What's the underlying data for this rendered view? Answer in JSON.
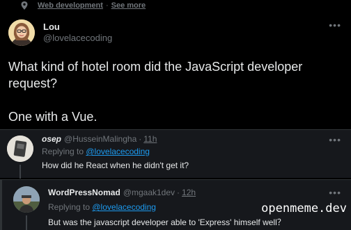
{
  "topic": {
    "label": "Web development",
    "separator": "·",
    "see_more": "See more"
  },
  "main_tweet": {
    "name": "Lou",
    "handle": "@lovelacecoding",
    "more": "•••",
    "text_line1": "What kind of hotel room did the JavaScript developer request?",
    "text_line2": "One with a Vue."
  },
  "replies": [
    {
      "name": "osep",
      "handle": "@HusseinMalingha",
      "separator": "·",
      "time": "11h",
      "more": "•••",
      "replying_prefix": "Replying to ",
      "replying_to": "@lovelacecoding",
      "text": "How did he React when he didn't get it?"
    },
    {
      "name": "WordPressNomad",
      "handle": "@mgaak1dev",
      "separator": "·",
      "time": "12h",
      "more": "•••",
      "replying_prefix": "Replying to ",
      "replying_to": "@lovelacecoding",
      "text": "But was the javascript developer able to 'Express' himself well？"
    }
  ],
  "watermark": "openmeme.dev",
  "colors": {
    "background": "#000000",
    "reply_background": "#16181c",
    "text": "#e7e9ea",
    "muted": "#71767b",
    "link": "#1d9bf0"
  },
  "icons": {
    "topic": "pin-icon",
    "more": "more-options-icon"
  }
}
